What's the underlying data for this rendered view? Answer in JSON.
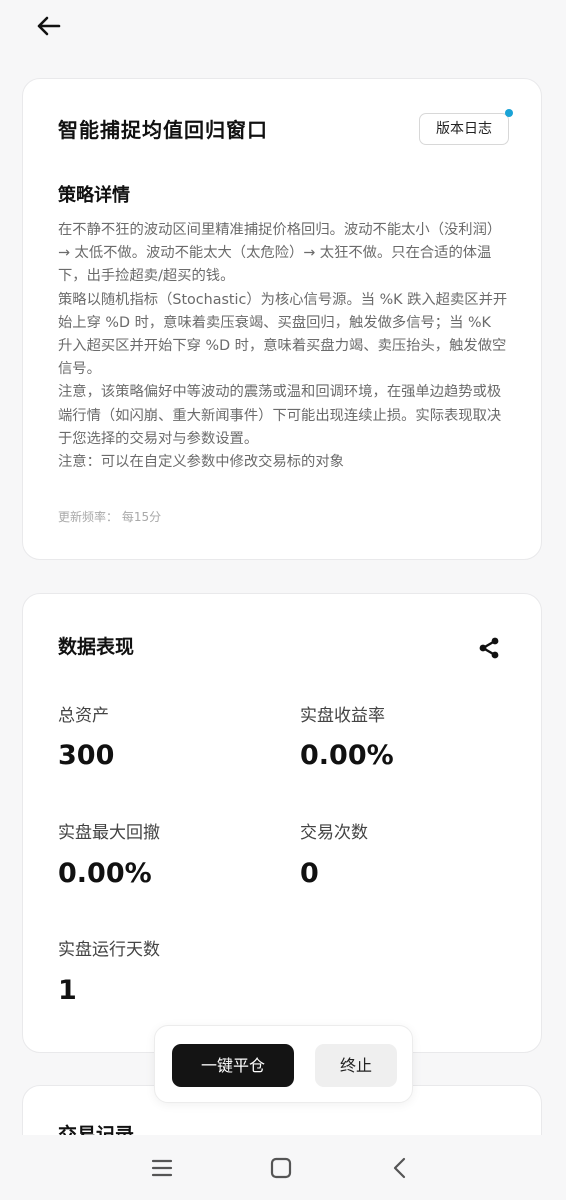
{
  "header": {
    "back_icon": "arrow-left-icon"
  },
  "strategy": {
    "title": "智能捕捉均值回归窗口",
    "changelog_label": "版本日志",
    "details_title": "策略详情",
    "description": "在不静不狂的波动区间里精准捕捉价格回归。波动不能太小（没利润）→ 太低不做。波动不能太大（太危险）→ 太狂不做。只在合适的体温下，出手捡超卖/超买的钱。\n策略以随机指标（Stochastic）为核心信号源。当 %K 跌入超卖区并开始上穿 %D 时，意味着卖压衰竭、买盘回归，触发做多信号；当 %K 升入超买区并开始下穿 %D 时，意味着买盘力竭、卖压抬头，触发做空信号。\n注意，该策略偏好中等波动的震荡或温和回调环境，在强单边趋势或极端行情（如闪崩、重大新闻事件）下可能出现连续止损。实际表现取决于您选择的交易对与参数设置。\n注意：可以在自定义参数中修改交易标的对象",
    "update_frequency": "更新频率：  每15分"
  },
  "performance": {
    "title": "数据表现",
    "share_icon": "share-icon",
    "metrics": [
      {
        "label": "总资产",
        "value": "300"
      },
      {
        "label": "实盘收益率",
        "value": "0.00%"
      },
      {
        "label": "实盘最大回撤",
        "value": "0.00%"
      },
      {
        "label": "交易次数",
        "value": "0"
      },
      {
        "label": "实盘运行天数",
        "value": "1"
      }
    ]
  },
  "records": {
    "title": "交易记录"
  },
  "actions": {
    "close_all_label": "一键平仓",
    "stop_label": "终止"
  },
  "navbar": {
    "menu_icon": "menu-icon",
    "home_icon": "home-icon",
    "back_icon": "chevron-left-icon"
  },
  "colors": {
    "accent_dot": "#1aa3d6",
    "primary_button": "#141414",
    "secondary_button": "#efefef"
  }
}
